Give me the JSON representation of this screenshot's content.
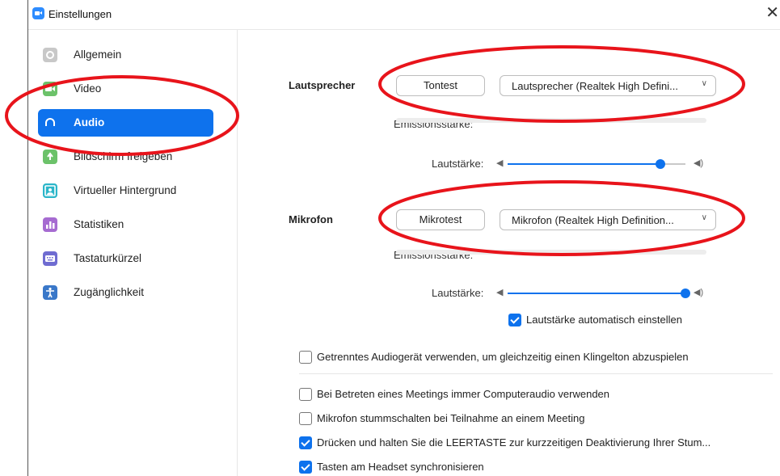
{
  "window": {
    "title": "Einstellungen",
    "close_glyph": "✕"
  },
  "sidebar": {
    "items": [
      {
        "label": "Allgemein",
        "icon": "gear-icon",
        "color": "#c8c8c8"
      },
      {
        "label": "Video",
        "icon": "video-camera-icon",
        "color": "#6cc26a"
      },
      {
        "label": "Audio",
        "icon": "headphones-icon",
        "color": "#0e72ed",
        "active": true
      },
      {
        "label": "Bildschirm freigeben",
        "icon": "share-screen-icon",
        "color": "#6cc26a"
      },
      {
        "label": "Virtueller Hintergrund",
        "icon": "virtual-background-icon",
        "color": "#2bb6c9"
      },
      {
        "label": "Statistiken",
        "icon": "statistics-icon",
        "color": "#a66bd1"
      },
      {
        "label": "Tastaturkürzel",
        "icon": "keyboard-icon",
        "color": "#6f6cd1"
      },
      {
        "label": "Zugänglichkeit",
        "icon": "accessibility-icon",
        "color": "#3a78c9"
      }
    ]
  },
  "speaker": {
    "label": "Lautsprecher",
    "test_button": "Tontest",
    "device": "Lautsprecher (Realtek High Defini...",
    "level_label": "Emissionsstärke:",
    "volume_label": "Lautstärke:",
    "volume": 0.86
  },
  "microphone": {
    "label": "Mikrofon",
    "test_button": "Mikrotest",
    "device": "Mikrofon (Realtek High Definition...",
    "level_label": "Emissionsstärke:",
    "volume_label": "Lautstärke:",
    "volume": 1.0,
    "auto_volume": {
      "label": "Lautstärke automatisch einstellen",
      "checked": true
    }
  },
  "options": [
    {
      "label": "Getrenntes Audiogerät verwenden, um gleichzeitig einen Klingelton abzuspielen",
      "checked": false
    },
    {
      "label": "Bei Betreten eines Meetings immer Computeraudio verwenden",
      "checked": false
    },
    {
      "label": "Mikrofon stummschalten bei Teilnahme an einem Meeting",
      "checked": false
    },
    {
      "label": "Drücken und halten Sie die LEERTASTE zur kurzzeitigen Deaktivierung Ihrer Stum...",
      "checked": true
    },
    {
      "label": "Tasten am Headset synchronisieren",
      "checked": true
    }
  ],
  "colors": {
    "accent": "#0e72ed",
    "annotation": "#e8141b"
  }
}
